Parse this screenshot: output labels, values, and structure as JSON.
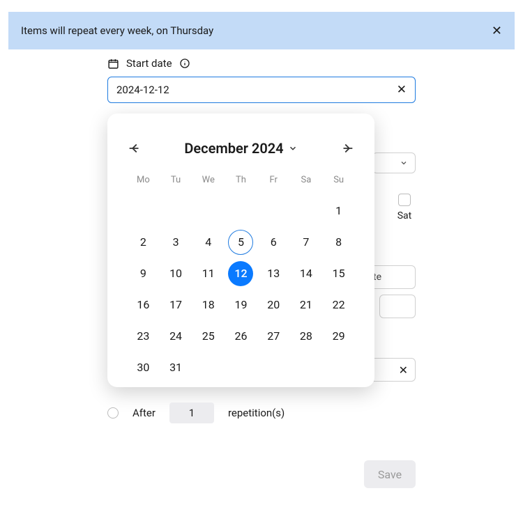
{
  "banner": {
    "text": "Items will repeat every week, on Thursday"
  },
  "startDate": {
    "label": "Start date",
    "value": "2024-12-12"
  },
  "calendar": {
    "title": "December 2024",
    "dow": [
      "Mo",
      "Tu",
      "We",
      "Th",
      "Fr",
      "Sa",
      "Su"
    ],
    "leadingBlank": 6,
    "daysInMonth": 31,
    "today": 5,
    "selected": 12
  },
  "saturday": {
    "label": "Sat"
  },
  "obscured": {
    "te": "te"
  },
  "after": {
    "label": "After",
    "value": "1",
    "suffix": "repetition(s)"
  },
  "save": {
    "label": "Save"
  }
}
